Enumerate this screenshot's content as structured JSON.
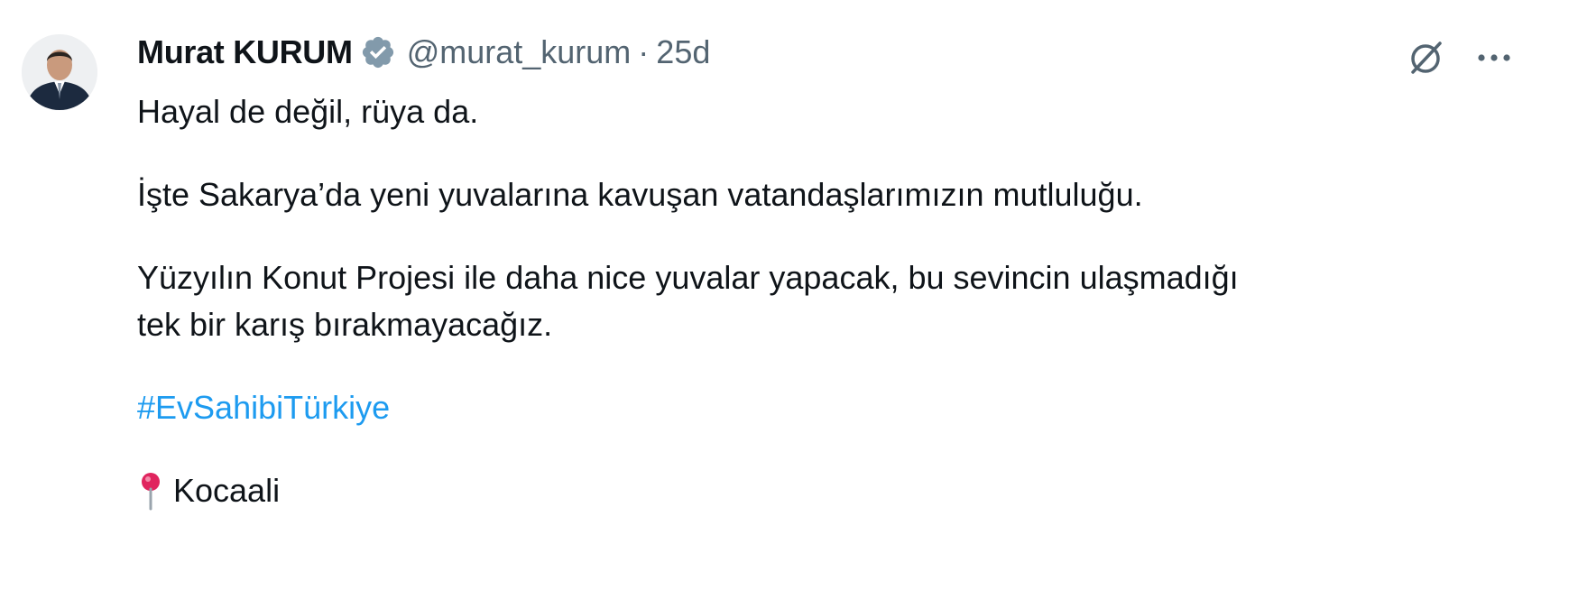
{
  "author": {
    "name": "Murat KURUM",
    "verified_icon": "verified-badge-icon",
    "handle": "@murat_kurum",
    "separator": "·",
    "time": "25d"
  },
  "actions": {
    "grok_icon": "grok-slash-icon",
    "more_icon": "more-dots-icon"
  },
  "tweet": {
    "line1": "Hayal de değil, rüya da.",
    "line2": "İşte Sakarya’da yeni yuvalarına kavuşan vatandaşlarımızın mutluluğu.",
    "line3a": "Yüzyılın Konut Projesi ile daha nice yuvalar yapacak, bu sevincin ulaşmadığı",
    "line3b": "tek bir karış bırakmayacağız.",
    "hashtag": "#EvSahibiTürkiye",
    "location_icon": "pin-icon",
    "location": "Kocaali"
  },
  "colors": {
    "text": "#0f1419",
    "secondary": "#536471",
    "link": "#1d9bf0",
    "verified": "#829aab"
  }
}
